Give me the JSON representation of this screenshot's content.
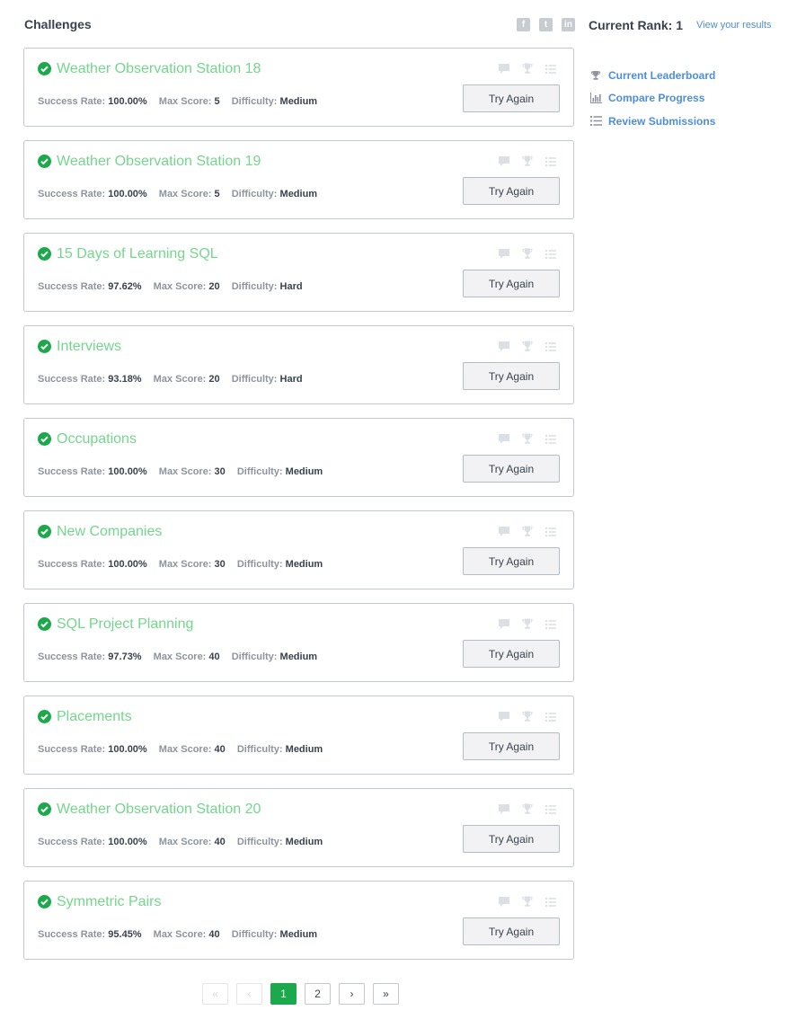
{
  "header": {
    "title": "Challenges",
    "social": [
      {
        "icon": "facebook-icon",
        "glyph": "f"
      },
      {
        "icon": "twitter-icon",
        "glyph": "t"
      },
      {
        "icon": "linkedin-icon",
        "glyph": "in"
      }
    ],
    "rank_text": "Current Rank: 1",
    "view_results": "View your results"
  },
  "sidebar": {
    "links": [
      {
        "label": "Current Leaderboard",
        "icon": "trophy-icon"
      },
      {
        "label": "Compare Progress",
        "icon": "bar-chart-icon"
      },
      {
        "label": "Review Submissions",
        "icon": "list-icon"
      }
    ]
  },
  "labels": {
    "success_rate": "Success Rate:",
    "max_score": "Max Score:",
    "difficulty": "Difficulty:",
    "try_again": "Try Again"
  },
  "challenges": [
    {
      "title": "Weather Observation Station 18",
      "success_rate": "100.00%",
      "max_score": "5",
      "difficulty": "Medium"
    },
    {
      "title": "Weather Observation Station 19",
      "success_rate": "100.00%",
      "max_score": "5",
      "difficulty": "Medium"
    },
    {
      "title": "15 Days of Learning SQL",
      "success_rate": "97.62%",
      "max_score": "20",
      "difficulty": "Hard"
    },
    {
      "title": "Interviews",
      "success_rate": "93.18%",
      "max_score": "20",
      "difficulty": "Hard"
    },
    {
      "title": "Occupations",
      "success_rate": "100.00%",
      "max_score": "30",
      "difficulty": "Medium"
    },
    {
      "title": "New Companies",
      "success_rate": "100.00%",
      "max_score": "30",
      "difficulty": "Medium"
    },
    {
      "title": "SQL Project Planning",
      "success_rate": "97.73%",
      "max_score": "40",
      "difficulty": "Medium"
    },
    {
      "title": "Placements",
      "success_rate": "100.00%",
      "max_score": "40",
      "difficulty": "Medium"
    },
    {
      "title": "Weather Observation Station 20",
      "success_rate": "100.00%",
      "max_score": "40",
      "difficulty": "Medium"
    },
    {
      "title": "Symmetric Pairs",
      "success_rate": "95.45%",
      "max_score": "40",
      "difficulty": "Medium"
    }
  ],
  "pagination": {
    "first": "«",
    "prev": "‹",
    "pages": [
      "1",
      "2"
    ],
    "current": "1",
    "next": "›",
    "last": "»"
  },
  "colors": {
    "accent_green": "#1ba94c",
    "title_green": "#74d68d",
    "link_blue": "#4d8ed9"
  }
}
